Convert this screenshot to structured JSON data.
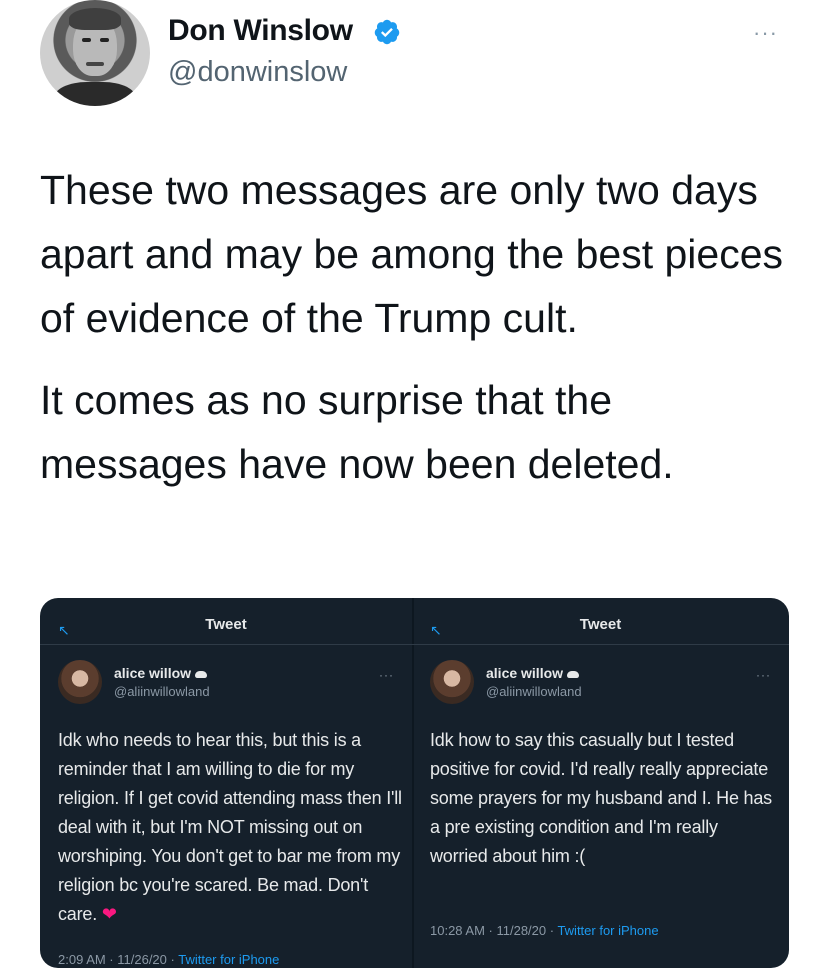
{
  "author": {
    "name": "Don Winslow",
    "handle": "@donwinslow",
    "verified_color": "#1d9bf0"
  },
  "more_icon": "···",
  "tweet": {
    "paragraphs": [
      "These two messages are only two days apart and may be among the best pieces of evidence of the Trump cult.",
      "It comes as no surprise that the messages have now been deleted."
    ]
  },
  "media": {
    "background": "#15202b",
    "screenshots": [
      {
        "header_title": "Tweet",
        "name": "alice willow",
        "handle": "@aliinwillowland",
        "more": "···",
        "text": "Idk who needs to hear this, but this is a reminder that I am willing to die for my religion. If I get covid attending mass then I'll deal with it, but I'm NOT missing out on worshiping. You don't get to bar me from my religion bc you're scared. Be mad. Don't care.",
        "heart": "❤",
        "time": "2:09 AM · 11/26/20 · ",
        "source": "Twitter for iPhone"
      },
      {
        "header_title": "Tweet",
        "name": "alice willow",
        "handle": "@aliinwillowland",
        "more": "···",
        "text": "Idk how to say this casually but I tested positive for covid. I'd really really appreciate some prayers for my husband and I. He has a pre existing condition and I'm really worried about him :(",
        "time": "10:28 AM · 11/28/20 · ",
        "source": "Twitter for iPhone"
      }
    ]
  }
}
